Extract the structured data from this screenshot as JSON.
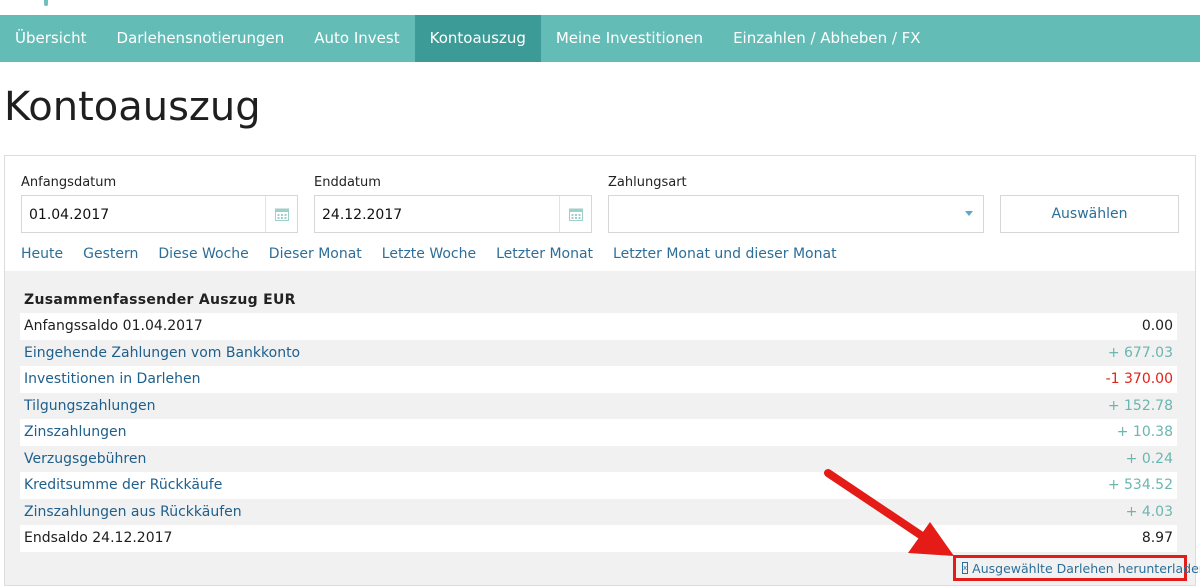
{
  "nav": {
    "items": [
      {
        "label": "Übersicht",
        "active": false
      },
      {
        "label": "Darlehensnotierungen",
        "active": false
      },
      {
        "label": "Auto Invest",
        "active": false
      },
      {
        "label": "Kontoauszug",
        "active": true
      },
      {
        "label": "Meine Investitionen",
        "active": false
      },
      {
        "label": "Einzahlen / Abheben / FX",
        "active": false
      }
    ]
  },
  "page": {
    "title": "Kontoauszug"
  },
  "filters": {
    "start_label": "Anfangsdatum",
    "start_value": "01.04.2017",
    "end_label": "Enddatum",
    "end_value": "24.12.2017",
    "type_label": "Zahlungsart",
    "type_value": "",
    "submit_label": "Auswählen",
    "quick": [
      "Heute",
      "Gestern",
      "Diese Woche",
      "Dieser Monat",
      "Letzte Woche",
      "Letzter Monat",
      "Letzter Monat und dieser Monat"
    ]
  },
  "summary": {
    "title": "Zusammenfassender Auszug EUR",
    "rows": [
      {
        "label": "Anfangssaldo 01.04.2017",
        "amount": "0.00",
        "kind": "plain"
      },
      {
        "label": "Eingehende Zahlungen vom Bankkonto",
        "amount": "+ 677.03",
        "kind": "pos"
      },
      {
        "label": "Investitionen in Darlehen",
        "amount": "-1 370.00",
        "kind": "neg"
      },
      {
        "label": "Tilgungszahlungen",
        "amount": "+ 152.78",
        "kind": "pos"
      },
      {
        "label": "Zinszahlungen",
        "amount": "+ 10.38",
        "kind": "pos"
      },
      {
        "label": "Verzugsgebühren",
        "amount": "+ 0.24",
        "kind": "pos"
      },
      {
        "label": "Kreditsumme der Rückkäufe",
        "amount": "+ 534.52",
        "kind": "pos"
      },
      {
        "label": "Zinszahlungen aus Rückkäufen",
        "amount": "+ 4.03",
        "kind": "pos"
      },
      {
        "label": "Endsaldo 24.12.2017",
        "amount": "8.97",
        "kind": "plain"
      }
    ]
  },
  "download": {
    "label": "Ausgewählte Darlehen herunterladen",
    "icon": "excel-file-icon"
  },
  "colors": {
    "nav_bg": "#63bcb6",
    "nav_active": "#3c9b96",
    "link": "#2c6e98",
    "positive": "#6ab6b0",
    "negative": "#e0231b",
    "highlight": "#e41b17"
  }
}
